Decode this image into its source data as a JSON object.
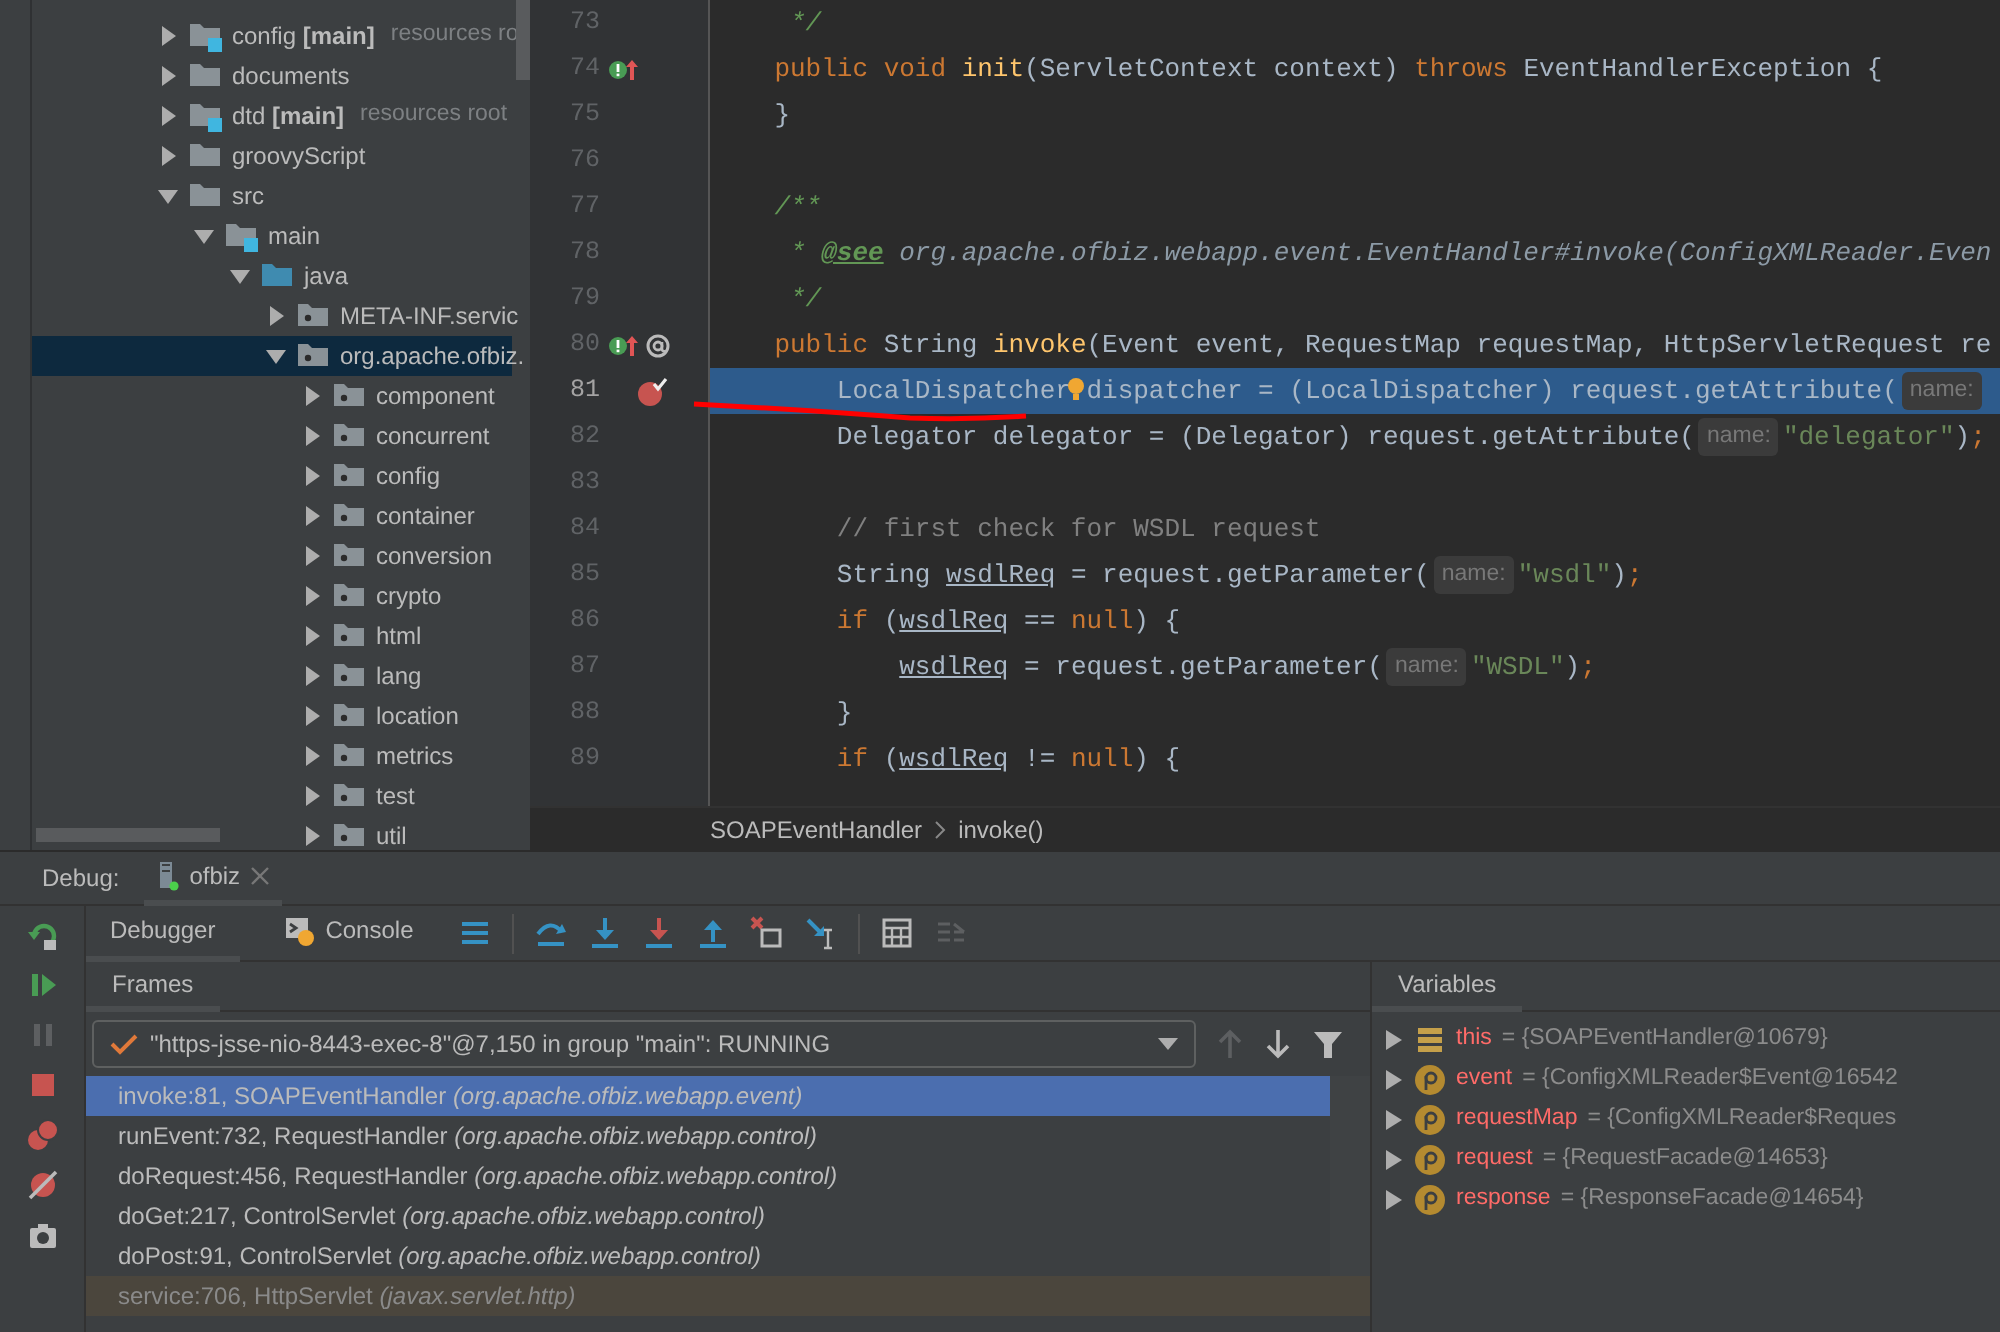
{
  "project_tree": {
    "items": [
      {
        "kind": "module",
        "label": "config **[main]**",
        "hint": "resources ro",
        "expanded": false,
        "selected": false
      },
      {
        "kind": "folder",
        "label": "documents",
        "expanded": false,
        "selected": false
      },
      {
        "kind": "module",
        "label": "dtd **[main]**",
        "hint": "resources root",
        "expanded": false,
        "selected": false
      },
      {
        "kind": "folder",
        "label": "groovyScript",
        "expanded": false,
        "selected": false
      },
      {
        "kind": "folder",
        "label": "src",
        "expanded": true,
        "selected": false,
        "children": [
          {
            "kind": "module",
            "label": "main",
            "expanded": true,
            "selected": false,
            "children": [
              {
                "kind": "source",
                "label": "java",
                "expanded": true,
                "selected": false,
                "children": [
                  {
                    "kind": "package",
                    "label": "META-INF.servic",
                    "expanded": false,
                    "selected": false
                  },
                  {
                    "kind": "package",
                    "label": "org.apache.ofbiz.",
                    "expanded": true,
                    "selected": true,
                    "children": [
                      {
                        "kind": "package",
                        "label": "component",
                        "expanded": false,
                        "selected": false
                      },
                      {
                        "kind": "package",
                        "label": "concurrent",
                        "expanded": false,
                        "selected": false
                      },
                      {
                        "kind": "package",
                        "label": "config",
                        "expanded": false,
                        "selected": false
                      },
                      {
                        "kind": "package",
                        "label": "container",
                        "expanded": false,
                        "selected": false
                      },
                      {
                        "kind": "package",
                        "label": "conversion",
                        "expanded": false,
                        "selected": false
                      },
                      {
                        "kind": "package",
                        "label": "crypto",
                        "expanded": false,
                        "selected": false
                      },
                      {
                        "kind": "package",
                        "label": "html",
                        "expanded": false,
                        "selected": false
                      },
                      {
                        "kind": "package",
                        "label": "lang",
                        "expanded": false,
                        "selected": false
                      },
                      {
                        "kind": "package",
                        "label": "location",
                        "expanded": false,
                        "selected": false
                      },
                      {
                        "kind": "package",
                        "label": "metrics",
                        "expanded": false,
                        "selected": false
                      },
                      {
                        "kind": "package",
                        "label": "test",
                        "expanded": false,
                        "selected": false
                      },
                      {
                        "kind": "package",
                        "label": "util",
                        "expanded": false,
                        "selected": false
                      }
                    ]
                  }
                ]
              }
            ]
          }
        ]
      }
    ]
  },
  "editor": {
    "lines": [
      {
        "number": "73",
        "selected": false,
        "tokens": [
          {
            "kind": "doc",
            "text": "     */"
          }
        ]
      },
      {
        "number": "74",
        "selected": false,
        "gutter": [
          {
            "kind": "override"
          }
        ],
        "tokens": [
          {
            "kind": "keyword",
            "text": "    public void "
          },
          {
            "kind": "method",
            "text": "init"
          },
          {
            "kind": "plain",
            "text": "(ServletContext context) "
          },
          {
            "kind": "keyword",
            "text": "throws"
          },
          {
            "kind": "plain",
            "text": " EventHandlerException {"
          }
        ]
      },
      {
        "number": "75",
        "selected": false,
        "tokens": [
          {
            "kind": "plain",
            "text": "    }"
          }
        ]
      },
      {
        "number": "76",
        "selected": false
      },
      {
        "number": "77",
        "selected": false,
        "tokens": [
          {
            "kind": "doc",
            "text": "    /**"
          }
        ]
      },
      {
        "number": "78",
        "selected": false,
        "tokens": [
          {
            "kind": "doc",
            "text": "     * "
          },
          {
            "kind": "doctag",
            "text": "@see"
          },
          {
            "kind": "docref",
            "text": " org.apache.ofbiz.webapp.event.EventHandler#invoke(ConfigXMLReader.Even"
          }
        ]
      },
      {
        "number": "79",
        "selected": false,
        "tokens": [
          {
            "kind": "doc",
            "text": "     */"
          }
        ]
      },
      {
        "number": "80",
        "selected": false,
        "gutter": [
          {
            "kind": "override"
          },
          {
            "kind": "annotation"
          }
        ],
        "tokens": [
          {
            "kind": "keyword",
            "text": "    public "
          },
          {
            "kind": "plain",
            "text": "String "
          },
          {
            "kind": "method",
            "text": "invoke"
          },
          {
            "kind": "plain",
            "text": "(Event event, RequestMap requestMap, HttpServletRequest re"
          }
        ]
      },
      {
        "number": "81",
        "selected": true,
        "gutter": [
          {
            "kind": "breakpoint"
          },
          {
            "kind": "bulb"
          }
        ],
        "tokens": [
          {
            "kind": "plain",
            "text": "        LocalDispatcher dispatcher = (LocalDispatcher) request.getAttribute("
          },
          {
            "kind": "hint",
            "text": "name:"
          }
        ]
      },
      {
        "number": "82",
        "selected": false,
        "tokens": [
          {
            "kind": "plain",
            "text": "        Delegator delegator = (Delegator) request.getAttribute("
          },
          {
            "kind": "hint",
            "text": "name:"
          },
          {
            "kind": "string",
            "text": "\"delegator\""
          },
          {
            "kind": "plain",
            "text": ")"
          },
          {
            "kind": "keyword",
            "text": ";"
          }
        ]
      },
      {
        "number": "83",
        "selected": false
      },
      {
        "number": "84",
        "selected": false,
        "tokens": [
          {
            "kind": "comment",
            "text": "        // first check for WSDL request"
          }
        ]
      },
      {
        "number": "85",
        "selected": false,
        "tokens": [
          {
            "kind": "plain",
            "text": "        String "
          },
          {
            "kind": "var",
            "text": "wsdlReq"
          },
          {
            "kind": "plain",
            "text": " = request.getParameter("
          },
          {
            "kind": "hint",
            "text": "name:"
          },
          {
            "kind": "string",
            "text": "\"wsdl\""
          },
          {
            "kind": "plain",
            "text": ")"
          },
          {
            "kind": "keyword",
            "text": ";"
          }
        ]
      },
      {
        "number": "86",
        "selected": false,
        "tokens": [
          {
            "kind": "keyword",
            "text": "        if"
          },
          {
            "kind": "plain",
            "text": " ("
          },
          {
            "kind": "var",
            "text": "wsdlReq"
          },
          {
            "kind": "plain",
            "text": " == "
          },
          {
            "kind": "keyword",
            "text": "null"
          },
          {
            "kind": "plain",
            "text": ") {"
          }
        ]
      },
      {
        "number": "87",
        "selected": false,
        "tokens": [
          {
            "kind": "var",
            "text": "            wsdlReq"
          },
          {
            "kind": "plain",
            "text": " = request.getParameter("
          },
          {
            "kind": "hint",
            "text": "name:"
          },
          {
            "kind": "string",
            "text": "\"WSDL\""
          },
          {
            "kind": "plain",
            "text": ")"
          },
          {
            "kind": "keyword",
            "text": ";"
          }
        ]
      },
      {
        "number": "88",
        "selected": false,
        "tokens": [
          {
            "kind": "plain",
            "text": "        }"
          }
        ]
      },
      {
        "number": "89",
        "selected": false,
        "tokens": [
          {
            "kind": "keyword",
            "text": "        if"
          },
          {
            "kind": "plain",
            "text": " ("
          },
          {
            "kind": "var",
            "text": "wsdlReq"
          },
          {
            "kind": "plain",
            "text": " != "
          },
          {
            "kind": "keyword",
            "text": "null"
          },
          {
            "kind": "plain",
            "text": ") {"
          }
        ]
      }
    ],
    "breadcrumb": [
      "SOAPEventHandler",
      "invoke()"
    ]
  },
  "debug": {
    "label": "Debug:",
    "session": "ofbiz",
    "tabs": [
      {
        "label": "Debugger",
        "selected": true
      },
      {
        "label": "Console",
        "selected": false
      }
    ],
    "frames": {
      "title": "Frames",
      "thread": "\"https-jsse-nio-8443-exec-8\"@7,150 in group \"main\": RUNNING",
      "items": [
        {
          "kind": "app",
          "text": "invoke:81, SOAPEventHandler *(org.apache.ofbiz.webapp.event)*",
          "selected": true
        },
        {
          "kind": "app",
          "text": "runEvent:732, RequestHandler *(org.apache.ofbiz.webapp.control)*",
          "selected": false
        },
        {
          "kind": "app",
          "text": "doRequest:456, RequestHandler *(org.apache.ofbiz.webapp.control)*",
          "selected": false
        },
        {
          "kind": "app",
          "text": "doGet:217, ControlServlet *(org.apache.ofbiz.webapp.control)*",
          "selected": false
        },
        {
          "kind": "app",
          "text": "doPost:91, ControlServlet *(org.apache.ofbiz.webapp.control)*",
          "selected": false
        },
        {
          "kind": "library",
          "text": "service:706, HttpServlet *(javax.servlet.http)*",
          "selected": false
        }
      ]
    },
    "variables": {
      "title": "Variables",
      "items": [
        {
          "kind": "field",
          "name": "this",
          "value": "= {SOAPEventHandler@10679}"
        },
        {
          "kind": "param",
          "name": "event",
          "value": "= {ConfigXMLReader$Event@16542"
        },
        {
          "kind": "param",
          "name": "requestMap",
          "value": "= {ConfigXMLReader$Reques"
        },
        {
          "kind": "param",
          "name": "request",
          "value": "= {RequestFacade@14653}"
        },
        {
          "kind": "param",
          "name": "response",
          "value": "= {ResponseFacade@14654}"
        }
      ]
    }
  }
}
